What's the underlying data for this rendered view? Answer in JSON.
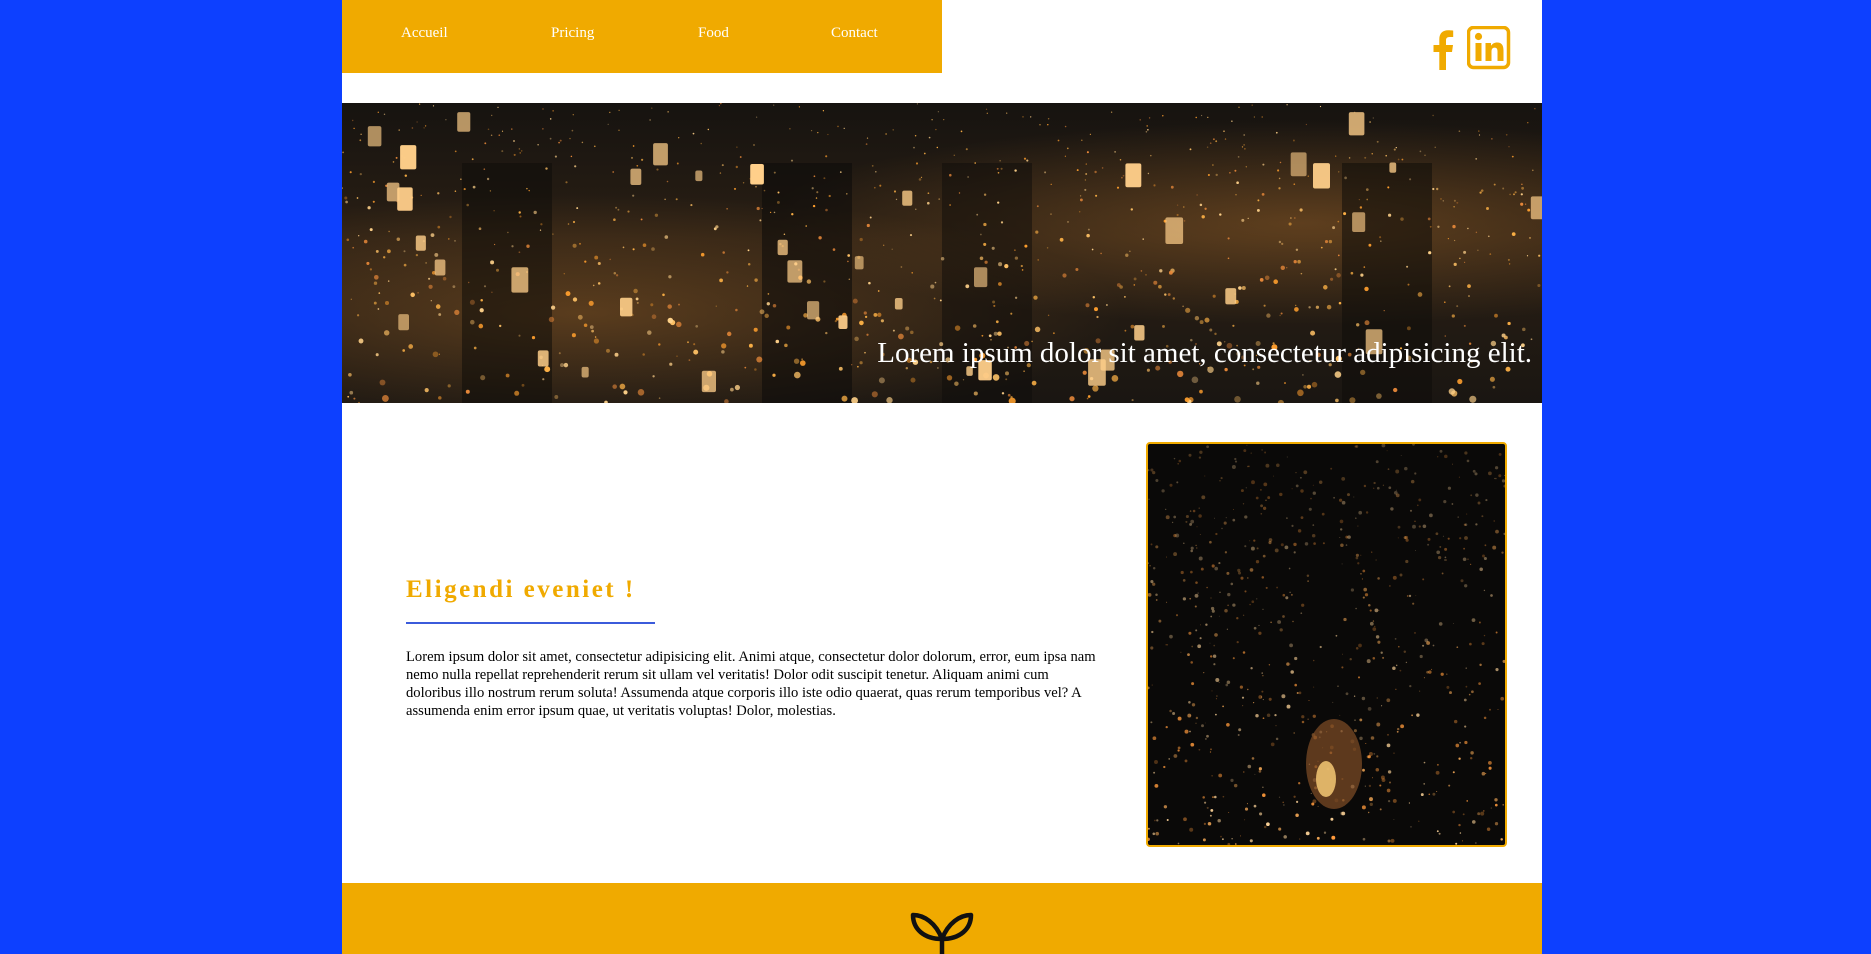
{
  "nav": {
    "items": [
      {
        "label": "Accueil"
      },
      {
        "label": "Pricing"
      },
      {
        "label": "Food"
      },
      {
        "label": "Contact"
      }
    ]
  },
  "social": {
    "icons": [
      "facebook-icon",
      "linkedin-icon"
    ]
  },
  "hero": {
    "caption": "Lorem ipsum dolor sit amet, consectetur adipisicing elit."
  },
  "content": {
    "title": "Eligendi eveniet !",
    "body": "Lorem ipsum dolor sit amet, consectetur adipisicing elit. Animi atque, consectetur dolor dolorum, error, eum ipsa nam nemo nulla repellat reprehenderit rerum sit ullam vel veritatis! Dolor odit suscipit tenetur. Aliquam animi cum doloribus illo nostrum rerum soluta! Assumenda atque corporis illo iste odio quaerat, quas rerum temporibus vel? A assumenda enim error ipsum quae, ut veritatis voluptas! Dolor, molestias."
  },
  "footer": {
    "icon": "sprout-icon"
  },
  "colors": {
    "background": "#0d40ff",
    "accent": "#f0aa00",
    "rule": "#3b5bdb",
    "page": "#ffffff"
  }
}
